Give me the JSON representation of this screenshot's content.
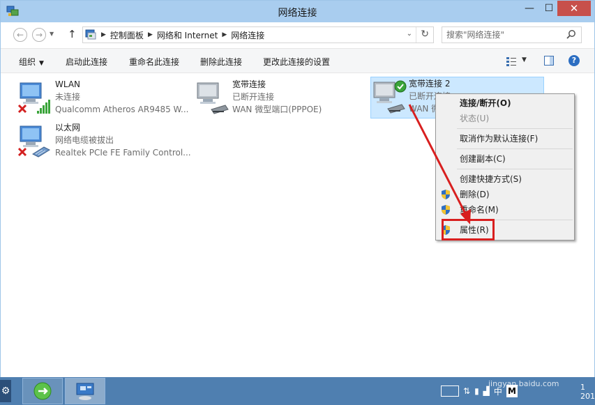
{
  "window": {
    "title": "网络连接"
  },
  "address": {
    "crumbs": [
      "控制面板",
      "网络和 Internet",
      "网络连接"
    ],
    "search_placeholder": "搜索\"网络连接\""
  },
  "commands": {
    "organize": "组织",
    "connect": "启动此连接",
    "rename": "重命名此连接",
    "delete": "删除此连接",
    "settings": "更改此连接的设置"
  },
  "connections": [
    {
      "name": "WLAN",
      "status": "未连接",
      "device": "Qualcomm Atheros AR9485 W...",
      "icon": "wifi-adapter-icon",
      "state": "disconnected"
    },
    {
      "name": "宽带连接",
      "status": "已断开连接",
      "device": "WAN 微型端口(PPPOE)",
      "icon": "broadband-icon",
      "state": "disconnected"
    },
    {
      "name": "宽带连接 2",
      "status": "已断开连接",
      "device": "WAN 微",
      "icon": "broadband-icon",
      "state": "selected"
    },
    {
      "name": "以太网",
      "status": "网络电缆被拔出",
      "device": "Realtek PCIe FE Family Control...",
      "icon": "ethernet-adapter-icon",
      "state": "disconnected"
    }
  ],
  "context_menu": {
    "items": [
      {
        "label": "连接/断开(O)",
        "bold": true
      },
      {
        "label": "状态(U)",
        "disabled": true
      },
      {
        "label": "取消作为默认连接(F)"
      },
      {
        "label": "创建副本(C)"
      },
      {
        "label": "创建快捷方式(S)"
      },
      {
        "label": "删除(D)",
        "shield": true
      },
      {
        "label": "重命名(M)",
        "shield": true
      },
      {
        "label": "属性(R)",
        "shield": true
      }
    ]
  },
  "taskbar": {
    "tray_lang": "中",
    "tray_ime": "M",
    "clock_line": "1",
    "clock_year": "201"
  },
  "watermark": {
    "text": "jingyan.baidu.com"
  },
  "colors": {
    "titlebar": "#a9cdef",
    "selection": "#cce8ff",
    "highlight": "#d81f1f",
    "taskbar": "#4f7fb0"
  }
}
